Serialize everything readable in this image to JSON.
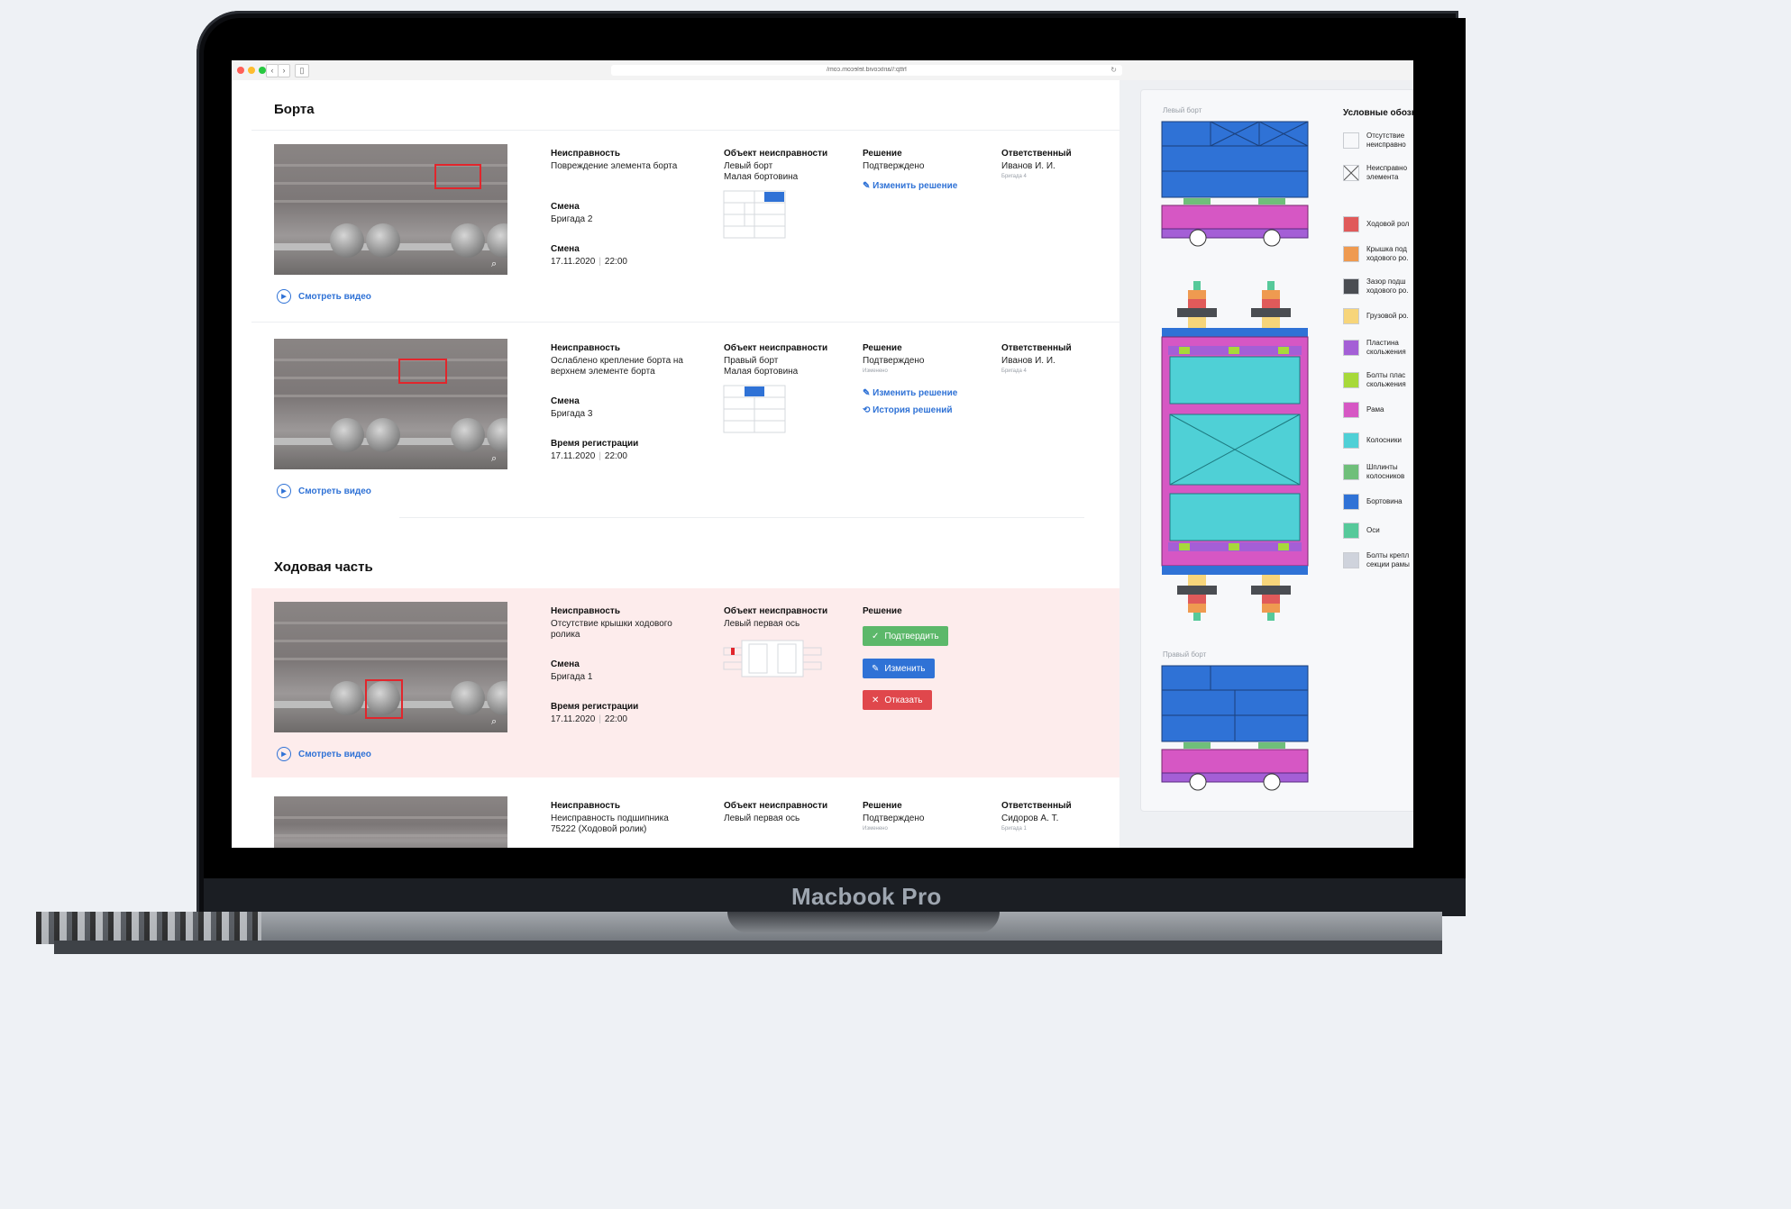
{
  "browser": {
    "url": "http:\\\\anticovid.telecom.com\\"
  },
  "sections": [
    {
      "title": "Борта"
    },
    {
      "title": "Ходовая часть"
    }
  ],
  "labels": {
    "fault": "Неисправность",
    "object": "Объект неисправности",
    "decision": "Решение",
    "responsible": "Ответственный",
    "shift": "Смена",
    "registration_time": "Время регистрации",
    "watch_video": "Смотреть видео",
    "changed": "Изменено"
  },
  "cards": [
    {
      "fault": "Повреждение элемента борта",
      "shift": "Бригада 2",
      "time_label": "Смена",
      "date": "17.11.2020",
      "time": "22:00",
      "object": "Левый борт\nМалая бортовина",
      "decision": "Подтверждено",
      "responsible": "Иванов И. И.",
      "brigade": "Бригада 4",
      "links": [
        "Изменить решение"
      ]
    },
    {
      "fault": "Ослаблено крепление борта на верхнем элементе борта",
      "shift": "Бригада 3",
      "time_label": "Время регистрации",
      "date": "17.11.2020",
      "time": "22:00",
      "object": "Правый борт\nМалая бортовина",
      "decision": "Подтверждено",
      "responsible": "Иванов И. И.",
      "brigade": "Бригада 4",
      "links": [
        "Изменить решение",
        "История решений"
      ]
    },
    {
      "fault": "Отсутствие крышки ходового ролика",
      "shift": "Бригада 1",
      "time_label": "Время регистрации",
      "date": "17.11.2020",
      "time": "22:00",
      "object": "Левый первая ось",
      "decision": "",
      "buttons": {
        "confirm": "Подтвердить",
        "edit": "Изменить",
        "reject": "Отказать"
      }
    },
    {
      "fault": "Неисправность подшипника 75222 (Ходовой ролик)",
      "object": "Левый первая ось",
      "decision": "Подтверждено",
      "responsible": "Сидоров А. Т.",
      "brigade": "Бригада 1"
    }
  ],
  "panel": {
    "left_side": "Левый борт",
    "right_side": "Правый борт",
    "legend_title": "Условные обозн",
    "legend": [
      {
        "label": "Отсутствие\nнеисправно",
        "color": "#f7f8fa"
      },
      {
        "label": "Неисправно\nэлемента",
        "color": "#f7f8fa"
      },
      {
        "label": "Ходовой рол",
        "color": "#e05a5a"
      },
      {
        "label": "Крышка под\nходового ро.",
        "color": "#ef9a50"
      },
      {
        "label": "Зазор подш\nходового ро.",
        "color": "#4a4d52"
      },
      {
        "label": "Грузовой ро.",
        "color": "#f7d57a"
      },
      {
        "label": "Пластина\nскольжения",
        "color": "#a45fd6"
      },
      {
        "label": "Болты плас\nскольжения",
        "color": "#a7d93a"
      },
      {
        "label": "Рама",
        "color": "#d657c4"
      },
      {
        "label": "Колосники",
        "color": "#4fd0d6"
      },
      {
        "label": "Шплинты\nколосников",
        "color": "#6fbf7a"
      },
      {
        "label": "Бортовина",
        "color": "#2f72d6"
      },
      {
        "label": "Оси",
        "color": "#56c99a"
      },
      {
        "label": "Болты крепл\nсекции рамы",
        "color": "#cfd3dc"
      }
    ]
  },
  "device": {
    "brand": "Macbook Pro"
  }
}
